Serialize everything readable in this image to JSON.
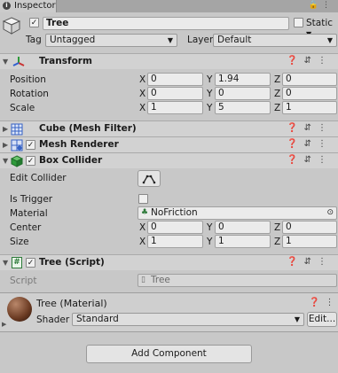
{
  "tab": {
    "label": "Inspector"
  },
  "object": {
    "name": "Tree",
    "static_label": "Static",
    "tag_label": "Tag",
    "tag_value": "Untagged",
    "layer_label": "Layer",
    "layer_value": "Default"
  },
  "transform": {
    "title": "Transform",
    "rows": [
      {
        "label": "Position",
        "x": "0",
        "y": "1.94",
        "z": "0"
      },
      {
        "label": "Rotation",
        "x": "0",
        "y": "0",
        "z": "0"
      },
      {
        "label": "Scale",
        "x": "1",
        "y": "5",
        "z": "1"
      }
    ]
  },
  "axis": {
    "x": "X",
    "y": "Y",
    "z": "Z"
  },
  "mesh_filter": {
    "title": "Cube (Mesh Filter)"
  },
  "mesh_renderer": {
    "title": "Mesh Renderer"
  },
  "box_collider": {
    "title": "Box Collider",
    "edit_collider_label": "Edit Collider",
    "is_trigger_label": "Is Trigger",
    "material_label": "Material",
    "material_value": "NoFriction",
    "center_label": "Center",
    "center": {
      "x": "0",
      "y": "0",
      "z": "0"
    },
    "size_label": "Size",
    "size": {
      "x": "1",
      "y": "1",
      "z": "1"
    }
  },
  "tree_script": {
    "title": "Tree (Script)",
    "script_label": "Script",
    "script_value": "Tree"
  },
  "material": {
    "title": "Tree (Material)",
    "shader_label": "Shader",
    "shader_value": "Standard",
    "edit_label": "Edit..."
  },
  "add_component_label": "Add Component",
  "colors": {
    "background": "#c8c8c8",
    "header": "#d2d2d2",
    "field": "#ebebeb",
    "transform_icon_red": "#c83232",
    "collider_icon_green": "#2e9a3a"
  }
}
